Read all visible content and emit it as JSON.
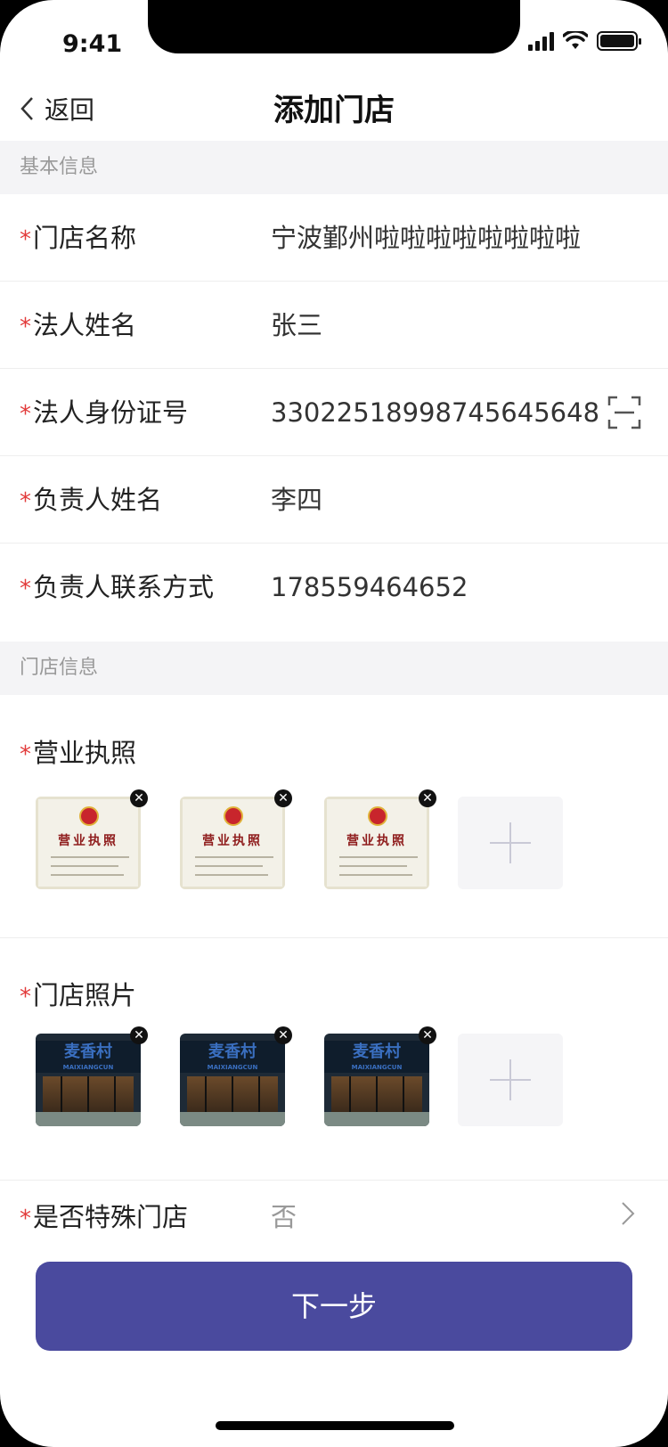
{
  "status_bar": {
    "time": "9:41"
  },
  "nav": {
    "back_label": "返回",
    "title": "添加门店"
  },
  "basic_section": {
    "header": "基本信息",
    "fields": [
      {
        "label": "门店名称",
        "value": "宁波鄞州啦啦啦啦啦啦啦啦",
        "required": true
      },
      {
        "label": "法人姓名",
        "value": "张三",
        "required": true
      },
      {
        "label": "法人身份证号",
        "value": "330225189987456456​48",
        "required": true,
        "icon": "scan-icon"
      },
      {
        "label": "负责人姓名",
        "value": "李四",
        "required": true
      },
      {
        "label": "负责人联系方式",
        "value": "178559464652",
        "required": true
      }
    ]
  },
  "store_section": {
    "header": "门店信息",
    "business_license": {
      "label": "营业执照",
      "required": true,
      "image_title": "营业执照",
      "images": 3
    },
    "store_photos": {
      "label": "门店照片",
      "required": true,
      "images": 3
    },
    "special_store": {
      "label": "是否特殊门店",
      "value": "否",
      "required": true
    }
  },
  "next_button": {
    "label": "下一步"
  },
  "colors": {
    "primary": "#4a4a9e",
    "required": "#e23b3b",
    "section_bg": "#f4f4f6"
  }
}
